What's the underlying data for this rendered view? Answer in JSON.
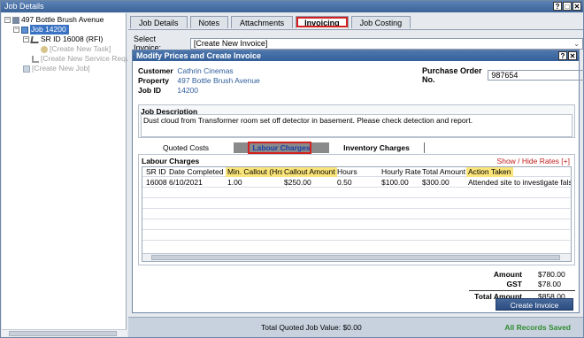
{
  "window": {
    "title": "Job Details",
    "buttons": [
      "?",
      "□",
      "✕"
    ]
  },
  "tree": {
    "items": [
      {
        "label": "497 Bottle Brush Avenue",
        "state": "normal"
      },
      {
        "label": "Job 14200",
        "state": "selected"
      },
      {
        "label": "SR ID 16008 (RFI)",
        "state": "normal"
      },
      {
        "label": "[Create New Task]",
        "state": "disabled"
      },
      {
        "label": "[Create New Service Request]",
        "state": "disabled"
      },
      {
        "label": "[Create New Job]",
        "state": "disabled"
      }
    ]
  },
  "tabs": [
    {
      "label": "Job Details",
      "active": false
    },
    {
      "label": "Notes",
      "active": false
    },
    {
      "label": "Attachments",
      "active": false
    },
    {
      "label": "Invoicing",
      "active": true
    },
    {
      "label": "Job Costing",
      "active": false
    }
  ],
  "select_invoice": {
    "label": "Select Invoice:",
    "value": "[Create New Invoice]"
  },
  "modal": {
    "title": "Modify Prices and Create Invoice",
    "buttons": [
      "?",
      "✕"
    ],
    "customer_label": "Customer",
    "customer": "Cathrin Cinemas",
    "property_label": "Property",
    "property": "497 Bottle Brush Avenue",
    "jobid_label": "Job ID",
    "jobid": "14200",
    "po_label": "Purchase Order No.",
    "po": "987654",
    "job_description_label": "Job Description",
    "job_description": "Dust cloud from Transformer room set off detector in basement. Please check detection and report.",
    "subtabs": {
      "quoted": "Quoted Costs",
      "labour": "Labour Charges",
      "inventory": "Inventory Charges"
    },
    "labour": {
      "title": "Labour Charges",
      "toggle_rates": "Show / Hide Rates [+]",
      "columns": [
        "SR ID",
        "Date Completed",
        "Min. Callout (Hrs)",
        "Callout Amount",
        "Hours",
        "Hourly Rate",
        "Total Amount",
        "Action Taken"
      ],
      "highlighted_columns": [
        2,
        3,
        7
      ],
      "rows": [
        [
          "16008",
          "6/10/2021",
          "1.00",
          "$250.00",
          "0.50",
          "$100.00",
          "$300.00",
          "Attended site to investigate false ala"
        ]
      ]
    },
    "totals": {
      "amount_label": "Amount",
      "amount": "$780.00",
      "gst_label": "GST",
      "gst": "$78.00",
      "total_label": "Total Amount",
      "total": "$858.00"
    },
    "create_button": "Create Invoice"
  },
  "footer": {
    "quoted_value": "Total Quoted Job Value: $0.00",
    "status": "All Records Saved"
  },
  "colors": {
    "accent": "#3a73c4",
    "highlight": "#fbe57a",
    "alert": "#d32020",
    "saved": "#2e8b2e"
  }
}
